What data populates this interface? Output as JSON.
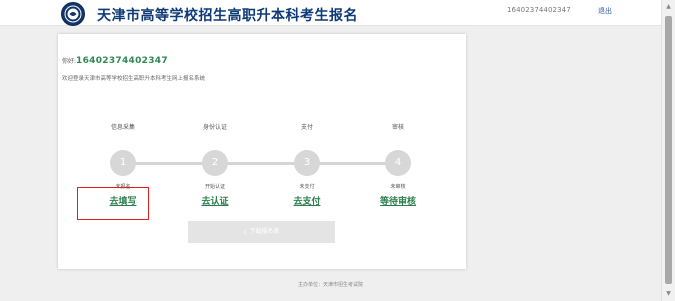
{
  "header": {
    "site_title": "天津市高等学校招生高职升本科考生报名",
    "user_id": "16402374402347",
    "logout_label": "退出"
  },
  "card": {
    "greeting_prefix": "你好:",
    "user_number": "16402374402347",
    "welcome": "欢迎登录天津市高等学校招生高职升本科考生网上报名系统",
    "steps": [
      {
        "title": "信息采集",
        "number": "1",
        "status": "未报名",
        "link": "去填写"
      },
      {
        "title": "身份认证",
        "number": "2",
        "status": "开始认证",
        "link": "去认证"
      },
      {
        "title": "支付",
        "number": "3",
        "status": "未支付",
        "link": "去支付"
      },
      {
        "title": "审核",
        "number": "4",
        "status": "未审核",
        "link": "等待审核"
      }
    ],
    "download_label": "下载报名表"
  },
  "footer": {
    "text": "主办单位：天津市招生考试院"
  },
  "colors": {
    "title_blue": "#0e3a77",
    "link_green": "#2b7d4c",
    "highlight_red": "#e02020",
    "step_gray": "#d7d7d7"
  },
  "icons": {
    "logo": "university-seal-icon",
    "download": "download-icon"
  }
}
